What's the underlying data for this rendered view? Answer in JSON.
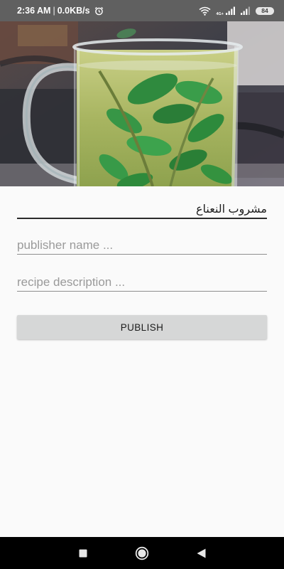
{
  "status_bar": {
    "time": "2:36 AM",
    "separator": "|",
    "speed": "0.0KB/s",
    "network_label": "4G+",
    "battery": "84",
    "icons": [
      "alarm-icon",
      "wifi-icon",
      "signal-icon",
      "signal-icon",
      "battery-icon"
    ]
  },
  "hero": {
    "icon": "mint-tea-photo"
  },
  "form": {
    "recipe_title": "مشروب النعناع",
    "publisher_placeholder": "publisher name ...",
    "publisher_value": "",
    "description_placeholder": "recipe description ...",
    "description_value": "",
    "publish_label": "PUBLISH"
  },
  "nav_bar": {
    "icons": [
      "recents-icon",
      "home-icon",
      "back-icon"
    ]
  },
  "colors": {
    "status_bar": "#606060",
    "background": "#fafafa",
    "button": "#d6d7d7",
    "nav_bar": "#000000"
  }
}
